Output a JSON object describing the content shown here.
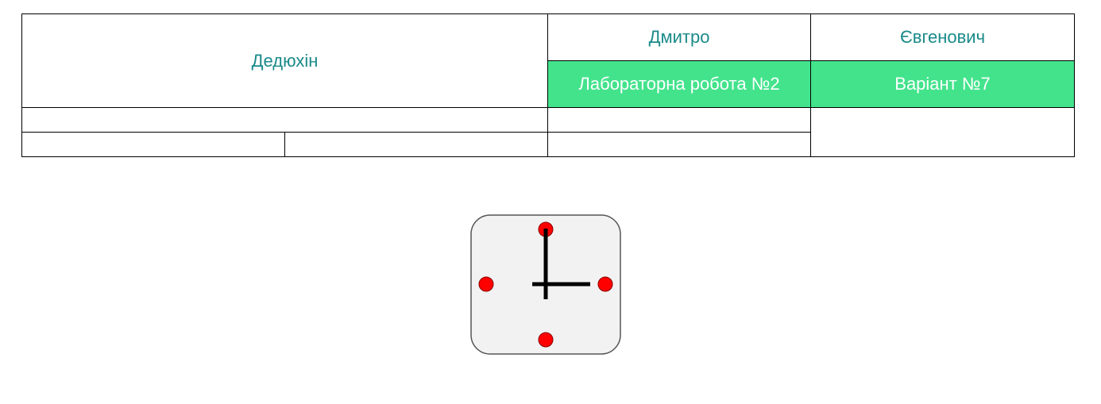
{
  "header_table": {
    "surname": "Дедюхін",
    "first_name": "Дмитро",
    "patronymic": "Євгенович",
    "lab_work": "Лабораторна робота №2",
    "variant": "Варіант №7"
  },
  "colors": {
    "name_text": "#1b8a8a",
    "highlight_background": "#43e38c",
    "highlight_text": "#ffffff",
    "clock_background": "#f2f2f2",
    "clock_marker": "#ff0000"
  },
  "clock_icon": {
    "icon": "clock-icon"
  }
}
